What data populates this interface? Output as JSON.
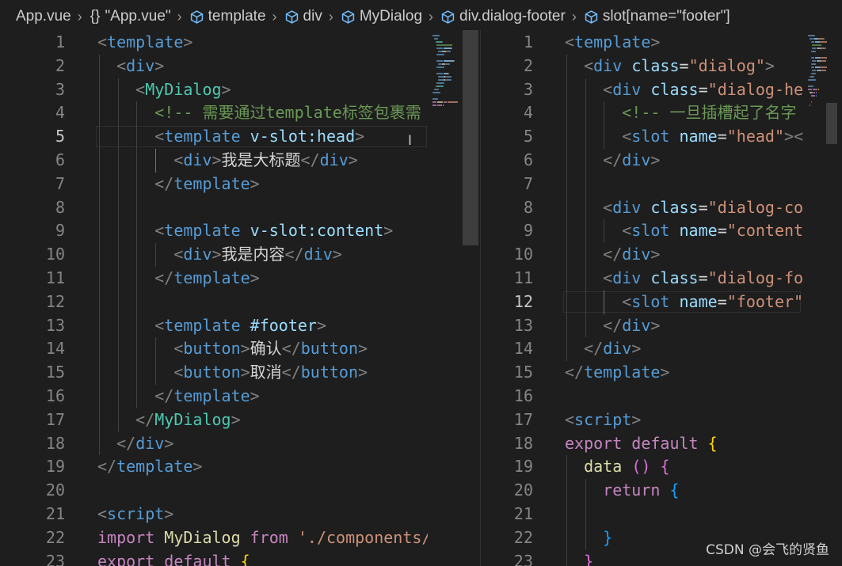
{
  "breadcrumb": [
    {
      "label": "App.vue",
      "icon": "none"
    },
    {
      "label": "\"App.vue\"",
      "icon": "braces"
    },
    {
      "label": "template",
      "icon": "cube"
    },
    {
      "label": "div",
      "icon": "cube"
    },
    {
      "label": "MyDialog",
      "icon": "cube"
    },
    {
      "label": "div.dialog-footer",
      "icon": "cube"
    },
    {
      "label": "slot[name=\"footer\"]",
      "icon": "cube"
    }
  ],
  "editors": {
    "left": {
      "active_line": 5,
      "lines": [
        {
          "n": "1",
          "tokens": [
            [
              "<",
              "bracket"
            ],
            [
              "template",
              "tag"
            ],
            [
              ">",
              "bracket"
            ]
          ]
        },
        {
          "n": "2",
          "tokens": [
            [
              "  ",
              "text"
            ],
            [
              "<",
              "bracket"
            ],
            [
              "div",
              "tag"
            ],
            [
              ">",
              "bracket"
            ]
          ]
        },
        {
          "n": "3",
          "tokens": [
            [
              "    ",
              "text"
            ],
            [
              "<",
              "bracket"
            ],
            [
              "MyDialog",
              "comp"
            ],
            [
              ">",
              "bracket"
            ]
          ]
        },
        {
          "n": "4",
          "tokens": [
            [
              "      ",
              "text"
            ],
            [
              "<!-- 需要通过template标签包裹需",
              "comment"
            ]
          ]
        },
        {
          "n": "5",
          "tokens": [
            [
              "      ",
              "text"
            ],
            [
              "<",
              "bracket"
            ],
            [
              "template",
              "tag"
            ],
            [
              " ",
              "text"
            ],
            [
              "v-slot:head",
              "attr"
            ],
            [
              ">",
              "bracket"
            ]
          ]
        },
        {
          "n": "6",
          "tokens": [
            [
              "        ",
              "text"
            ],
            [
              "<",
              "bracket"
            ],
            [
              "div",
              "tag"
            ],
            [
              ">",
              "bracket"
            ],
            [
              "我是大标题",
              "text"
            ],
            [
              "</",
              "bracket"
            ],
            [
              "div",
              "tag"
            ],
            [
              ">",
              "bracket"
            ]
          ]
        },
        {
          "n": "7",
          "tokens": [
            [
              "      ",
              "text"
            ],
            [
              "</",
              "bracket"
            ],
            [
              "template",
              "tag"
            ],
            [
              ">",
              "bracket"
            ]
          ]
        },
        {
          "n": "8",
          "tokens": []
        },
        {
          "n": "9",
          "tokens": [
            [
              "      ",
              "text"
            ],
            [
              "<",
              "bracket"
            ],
            [
              "template",
              "tag"
            ],
            [
              " ",
              "text"
            ],
            [
              "v-slot:content",
              "attr"
            ],
            [
              ">",
              "bracket"
            ]
          ]
        },
        {
          "n": "10",
          "tokens": [
            [
              "        ",
              "text"
            ],
            [
              "<",
              "bracket"
            ],
            [
              "div",
              "tag"
            ],
            [
              ">",
              "bracket"
            ],
            [
              "我是内容",
              "text"
            ],
            [
              "</",
              "bracket"
            ],
            [
              "div",
              "tag"
            ],
            [
              ">",
              "bracket"
            ]
          ]
        },
        {
          "n": "11",
          "tokens": [
            [
              "      ",
              "text"
            ],
            [
              "</",
              "bracket"
            ],
            [
              "template",
              "tag"
            ],
            [
              ">",
              "bracket"
            ]
          ]
        },
        {
          "n": "12",
          "tokens": []
        },
        {
          "n": "13",
          "tokens": [
            [
              "      ",
              "text"
            ],
            [
              "<",
              "bracket"
            ],
            [
              "template",
              "tag"
            ],
            [
              " ",
              "text"
            ],
            [
              "#footer",
              "attr"
            ],
            [
              ">",
              "bracket"
            ]
          ]
        },
        {
          "n": "14",
          "tokens": [
            [
              "        ",
              "text"
            ],
            [
              "<",
              "bracket"
            ],
            [
              "button",
              "tag"
            ],
            [
              ">",
              "bracket"
            ],
            [
              "确认",
              "text"
            ],
            [
              "</",
              "bracket"
            ],
            [
              "button",
              "tag"
            ],
            [
              ">",
              "bracket"
            ]
          ]
        },
        {
          "n": "15",
          "tokens": [
            [
              "        ",
              "text"
            ],
            [
              "<",
              "bracket"
            ],
            [
              "button",
              "tag"
            ],
            [
              ">",
              "bracket"
            ],
            [
              "取消",
              "text"
            ],
            [
              "</",
              "bracket"
            ],
            [
              "button",
              "tag"
            ],
            [
              ">",
              "bracket"
            ]
          ]
        },
        {
          "n": "16",
          "tokens": [
            [
              "      ",
              "text"
            ],
            [
              "</",
              "bracket"
            ],
            [
              "template",
              "tag"
            ],
            [
              ">",
              "bracket"
            ]
          ]
        },
        {
          "n": "17",
          "tokens": [
            [
              "    ",
              "text"
            ],
            [
              "</",
              "bracket"
            ],
            [
              "MyDialog",
              "comp"
            ],
            [
              ">",
              "bracket"
            ]
          ]
        },
        {
          "n": "18",
          "tokens": [
            [
              "  ",
              "text"
            ],
            [
              "</",
              "bracket"
            ],
            [
              "div",
              "tag"
            ],
            [
              ">",
              "bracket"
            ]
          ]
        },
        {
          "n": "19",
          "tokens": [
            [
              "</",
              "bracket"
            ],
            [
              "template",
              "tag"
            ],
            [
              ">",
              "bracket"
            ]
          ]
        },
        {
          "n": "20",
          "tokens": []
        },
        {
          "n": "21",
          "tokens": [
            [
              "<",
              "bracket"
            ],
            [
              "script",
              "tag"
            ],
            [
              ">",
              "bracket"
            ]
          ]
        },
        {
          "n": "22",
          "tokens": [
            [
              "import",
              "keyword"
            ],
            [
              " ",
              "text"
            ],
            [
              "MyDialog",
              "fn"
            ],
            [
              " ",
              "text"
            ],
            [
              "from",
              "keyword"
            ],
            [
              " ",
              "text"
            ],
            [
              "'./components/",
              "str"
            ]
          ]
        },
        {
          "n": "23",
          "tokens": [
            [
              "export",
              "keyword"
            ],
            [
              " ",
              "text"
            ],
            [
              "default",
              "keyword"
            ],
            [
              " ",
              "text"
            ],
            [
              "{",
              "brace"
            ]
          ]
        }
      ]
    },
    "right": {
      "active_line": 12,
      "lines": [
        {
          "n": "1",
          "tokens": [
            [
              "<",
              "bracket"
            ],
            [
              "template",
              "tag"
            ],
            [
              ">",
              "bracket"
            ]
          ]
        },
        {
          "n": "2",
          "tokens": [
            [
              "  ",
              "text"
            ],
            [
              "<",
              "bracket"
            ],
            [
              "div",
              "tag"
            ],
            [
              " ",
              "text"
            ],
            [
              "class",
              "attr"
            ],
            [
              "=",
              "text"
            ],
            [
              "\"dialog\"",
              "str"
            ],
            [
              ">",
              "bracket"
            ]
          ]
        },
        {
          "n": "3",
          "tokens": [
            [
              "    ",
              "text"
            ],
            [
              "<",
              "bracket"
            ],
            [
              "div",
              "tag"
            ],
            [
              " ",
              "text"
            ],
            [
              "class",
              "attr"
            ],
            [
              "=",
              "text"
            ],
            [
              "\"dialog-he",
              "str"
            ]
          ]
        },
        {
          "n": "4",
          "tokens": [
            [
              "      ",
              "text"
            ],
            [
              "<!-- 一旦插槽起了名字",
              "comment"
            ]
          ]
        },
        {
          "n": "5",
          "tokens": [
            [
              "      ",
              "text"
            ],
            [
              "<",
              "bracket"
            ],
            [
              "slot",
              "tag"
            ],
            [
              " ",
              "text"
            ],
            [
              "name",
              "attr"
            ],
            [
              "=",
              "text"
            ],
            [
              "\"head\"",
              "str"
            ],
            [
              "><",
              "bracket"
            ]
          ]
        },
        {
          "n": "6",
          "tokens": [
            [
              "    ",
              "text"
            ],
            [
              "</",
              "bracket"
            ],
            [
              "div",
              "tag"
            ],
            [
              ">",
              "bracket"
            ]
          ]
        },
        {
          "n": "7",
          "tokens": []
        },
        {
          "n": "8",
          "tokens": [
            [
              "    ",
              "text"
            ],
            [
              "<",
              "bracket"
            ],
            [
              "div",
              "tag"
            ],
            [
              " ",
              "text"
            ],
            [
              "class",
              "attr"
            ],
            [
              "=",
              "text"
            ],
            [
              "\"dialog-co",
              "str"
            ]
          ]
        },
        {
          "n": "9",
          "tokens": [
            [
              "      ",
              "text"
            ],
            [
              "<",
              "bracket"
            ],
            [
              "slot",
              "tag"
            ],
            [
              " ",
              "text"
            ],
            [
              "name",
              "attr"
            ],
            [
              "=",
              "text"
            ],
            [
              "\"content",
              "str"
            ]
          ]
        },
        {
          "n": "10",
          "tokens": [
            [
              "    ",
              "text"
            ],
            [
              "</",
              "bracket"
            ],
            [
              "div",
              "tag"
            ],
            [
              ">",
              "bracket"
            ]
          ]
        },
        {
          "n": "11",
          "tokens": [
            [
              "    ",
              "text"
            ],
            [
              "<",
              "bracket"
            ],
            [
              "div",
              "tag"
            ],
            [
              " ",
              "text"
            ],
            [
              "class",
              "attr"
            ],
            [
              "=",
              "text"
            ],
            [
              "\"dialog-fo",
              "str"
            ]
          ]
        },
        {
          "n": "12",
          "tokens": [
            [
              "      ",
              "text"
            ],
            [
              "<",
              "bracket"
            ],
            [
              "slot",
              "tag"
            ],
            [
              " ",
              "text"
            ],
            [
              "name",
              "attr"
            ],
            [
              "=",
              "text"
            ],
            [
              "\"footer\"",
              "str"
            ]
          ]
        },
        {
          "n": "13",
          "tokens": [
            [
              "    ",
              "text"
            ],
            [
              "</",
              "bracket"
            ],
            [
              "div",
              "tag"
            ],
            [
              ">",
              "bracket"
            ]
          ]
        },
        {
          "n": "14",
          "tokens": [
            [
              "  ",
              "text"
            ],
            [
              "</",
              "bracket"
            ],
            [
              "div",
              "tag"
            ],
            [
              ">",
              "bracket"
            ]
          ]
        },
        {
          "n": "15",
          "tokens": [
            [
              "</",
              "bracket"
            ],
            [
              "template",
              "tag"
            ],
            [
              ">",
              "bracket"
            ]
          ]
        },
        {
          "n": "16",
          "tokens": []
        },
        {
          "n": "17",
          "tokens": [
            [
              "<",
              "bracket"
            ],
            [
              "script",
              "tag"
            ],
            [
              ">",
              "bracket"
            ]
          ]
        },
        {
          "n": "18",
          "tokens": [
            [
              "export",
              "keyword"
            ],
            [
              " ",
              "text"
            ],
            [
              "default",
              "keyword"
            ],
            [
              " ",
              "text"
            ],
            [
              "{",
              "brace"
            ]
          ]
        },
        {
          "n": "19",
          "tokens": [
            [
              "  ",
              "text"
            ],
            [
              "data",
              "fn"
            ],
            [
              " ",
              "text"
            ],
            [
              "()",
              "brace2"
            ],
            [
              " ",
              "text"
            ],
            [
              "{",
              "brace2"
            ]
          ]
        },
        {
          "n": "20",
          "tokens": [
            [
              "    ",
              "text"
            ],
            [
              "return",
              "keyword"
            ],
            [
              " ",
              "text"
            ],
            [
              "{",
              "brace3"
            ]
          ]
        },
        {
          "n": "21",
          "tokens": []
        },
        {
          "n": "22",
          "tokens": [
            [
              "    ",
              "text"
            ],
            [
              "}",
              "brace3"
            ]
          ]
        },
        {
          "n": "23",
          "tokens": [
            [
              "  ",
              "text"
            ],
            [
              "}",
              "brace2"
            ]
          ]
        }
      ]
    }
  },
  "watermark": "CSDN @会飞的贤鱼",
  "colors": {
    "background": "#1e1e1e",
    "tag": "#569cd6",
    "component": "#4ec9b0",
    "attribute": "#9cdcfe",
    "string": "#ce9178",
    "comment": "#6a9955",
    "keyword": "#c586c0",
    "function": "#dcdcaa"
  }
}
